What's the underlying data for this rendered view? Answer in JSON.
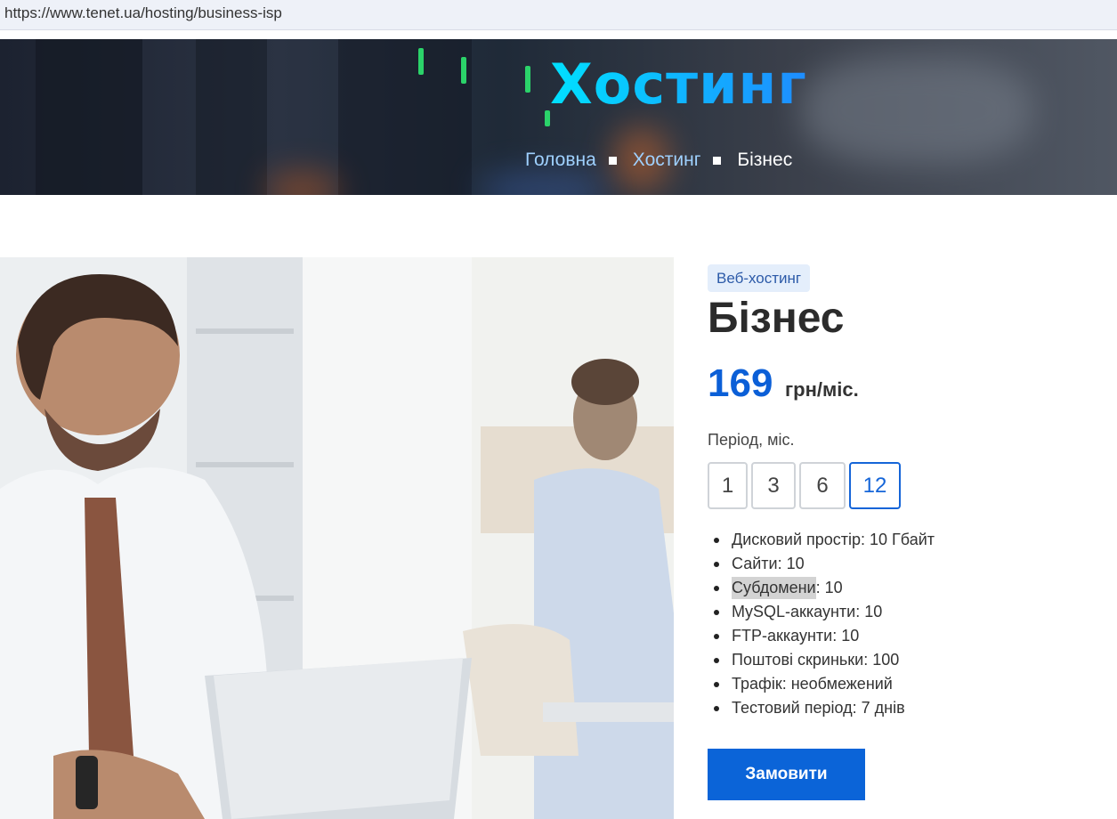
{
  "browser": {
    "url": "https://www.tenet.ua/hosting/business-isp"
  },
  "hero": {
    "title": "Хостинг",
    "breadcrumb": [
      {
        "label": "Головна"
      },
      {
        "label": "Хостинг"
      },
      {
        "label": "Бізнес"
      }
    ]
  },
  "product": {
    "badge": "Веб-хостинг",
    "name": "Бізнес",
    "price": "169",
    "price_unit": "грн/міс.",
    "period_label": "Період, міс.",
    "periods": [
      "1",
      "3",
      "6",
      "12"
    ],
    "selected_period": "12",
    "features": [
      {
        "key": "Дисковий простір",
        "value": ": 10 Гбайт"
      },
      {
        "key": "Сайти",
        "value": ": 10"
      },
      {
        "key": "Субдомени",
        "value": ": 10"
      },
      {
        "key": "MySQL-аккаунти",
        "value": ": 10"
      },
      {
        "key": "FTP-аккаунти",
        "value": ": 10"
      },
      {
        "key": "Поштові скриньки",
        "value": ": 100"
      },
      {
        "key": "Трафік",
        "value": ": необмежений"
      },
      {
        "key": "Тестовий період",
        "value": ": 7 днів"
      }
    ],
    "order_label": "Замовити"
  },
  "colors": {
    "accent": "#0b64d8",
    "price": "#0b5fd7",
    "badge_bg": "#e4eefb"
  }
}
